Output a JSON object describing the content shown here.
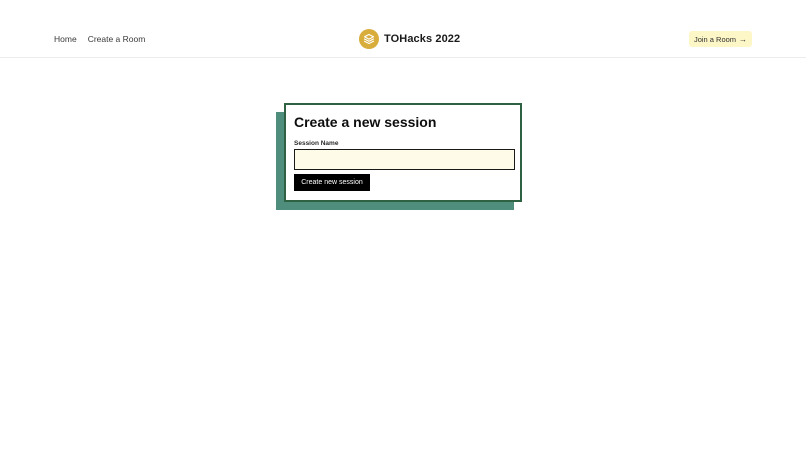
{
  "header": {
    "nav": [
      {
        "label": "Home"
      },
      {
        "label": "Create a Room"
      }
    ],
    "brand": {
      "title": "TOHacks 2022",
      "logo_icon": "stack-layers-icon"
    },
    "join_button": {
      "label": "Join a Room",
      "arrow": "→"
    }
  },
  "session_form": {
    "title": "Create a new session",
    "field_label": "Session Name",
    "field_value": "",
    "submit_label": "Create new session"
  },
  "colors": {
    "logo": "#d9ad3c",
    "join_button_bg": "#fdf7c8",
    "card_border": "#2f6242",
    "card_shadow": "#4f8e7c",
    "input_bg": "#fffbe9",
    "submit_bg": "#000000"
  }
}
